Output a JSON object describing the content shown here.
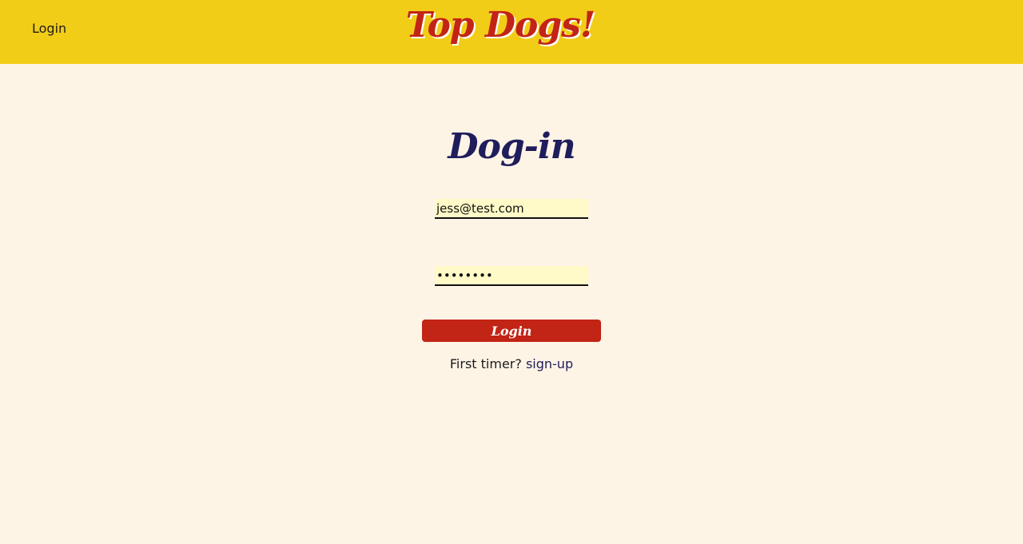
{
  "header": {
    "nav_login_label": "Login",
    "brand": "Top Dogs!"
  },
  "form": {
    "title": "Dog-in",
    "email_value": "jess@test.com",
    "password_value": "password",
    "submit_label": "Login",
    "prompt_text": "First timer?",
    "signup_label": "sign-up"
  },
  "colors": {
    "header_bg": "#f2cd17",
    "page_bg": "#fef4e6",
    "brand": "#c22415",
    "title": "#1f1d5b",
    "input_bg": "#fffac8",
    "button": "#c22415"
  }
}
